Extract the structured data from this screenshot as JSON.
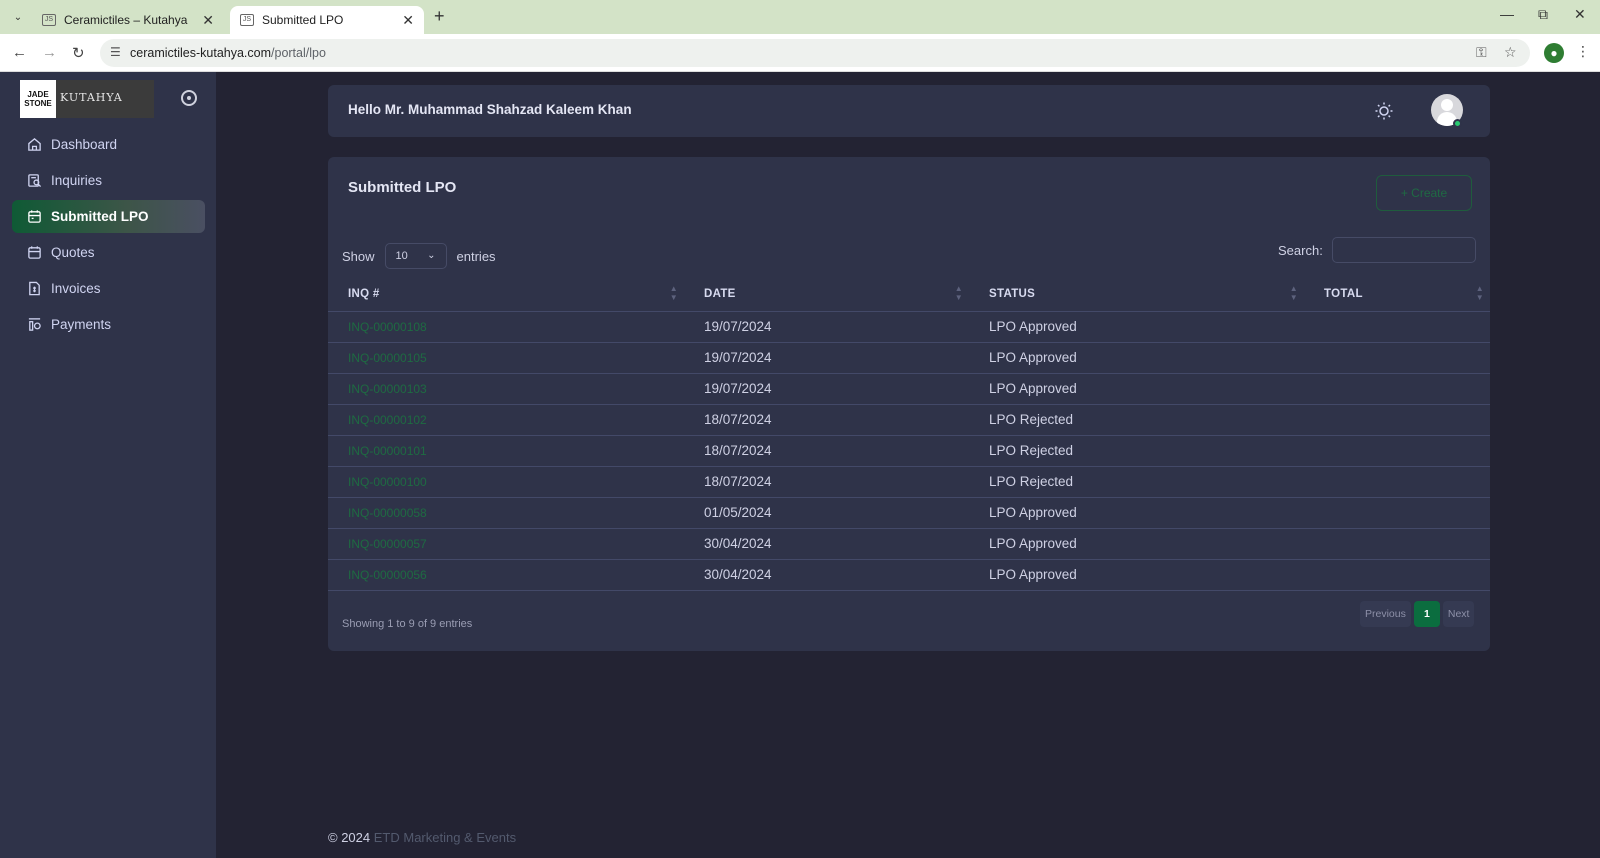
{
  "browser": {
    "tabs": [
      {
        "title": "Ceramictiles – Kutahya"
      },
      {
        "title": "Submitted LPO"
      }
    ],
    "url_domain": "ceramictiles-kutahya.com",
    "url_path": "/portal/lpo"
  },
  "sidebar": {
    "logo_left": "JADE STONE",
    "logo_right": "KUTAHYA",
    "items": [
      {
        "label": "Dashboard",
        "icon": "home-icon"
      },
      {
        "label": "Inquiries",
        "icon": "inquiry-icon"
      },
      {
        "label": "Submitted LPO",
        "icon": "calendar-icon",
        "active": true
      },
      {
        "label": "Quotes",
        "icon": "calendar-icon"
      },
      {
        "label": "Invoices",
        "icon": "invoice-icon"
      },
      {
        "label": "Payments",
        "icon": "payments-icon"
      }
    ]
  },
  "header": {
    "greeting": "Hello Mr. Muhammad Shahzad Kaleem Khan"
  },
  "card": {
    "title": "Submitted LPO",
    "create_label": "+ Create",
    "show_label": "Show",
    "entries_label": "entries",
    "page_size": "10",
    "search_label": "Search:",
    "columns": [
      "INQ #",
      "DATE",
      "STATUS",
      "TOTAL"
    ],
    "rows": [
      {
        "inq": "INQ-00000108",
        "date": "19/07/2024",
        "status": "LPO Approved",
        "total": ""
      },
      {
        "inq": "INQ-00000105",
        "date": "19/07/2024",
        "status": "LPO Approved",
        "total": ""
      },
      {
        "inq": "INQ-00000103",
        "date": "19/07/2024",
        "status": "LPO Approved",
        "total": ""
      },
      {
        "inq": "INQ-00000102",
        "date": "18/07/2024",
        "status": "LPO Rejected",
        "total": ""
      },
      {
        "inq": "INQ-00000101",
        "date": "18/07/2024",
        "status": "LPO Rejected",
        "total": ""
      },
      {
        "inq": "INQ-00000100",
        "date": "18/07/2024",
        "status": "LPO Rejected",
        "total": ""
      },
      {
        "inq": "INQ-00000058",
        "date": "01/05/2024",
        "status": "LPO Approved",
        "total": ""
      },
      {
        "inq": "INQ-00000057",
        "date": "30/04/2024",
        "status": "LPO Approved",
        "total": ""
      },
      {
        "inq": "INQ-00000056",
        "date": "30/04/2024",
        "status": "LPO Approved",
        "total": ""
      }
    ],
    "info": "Showing 1 to 9 of 9 entries",
    "pagination": {
      "previous": "Previous",
      "current": "1",
      "next": "Next"
    }
  },
  "footer": {
    "copyright": "© 2024",
    "link": "ETD Marketing & Events"
  },
  "colors": {
    "background": "#232333",
    "panel": "#2f3349",
    "accent": "#0b6d3f"
  }
}
